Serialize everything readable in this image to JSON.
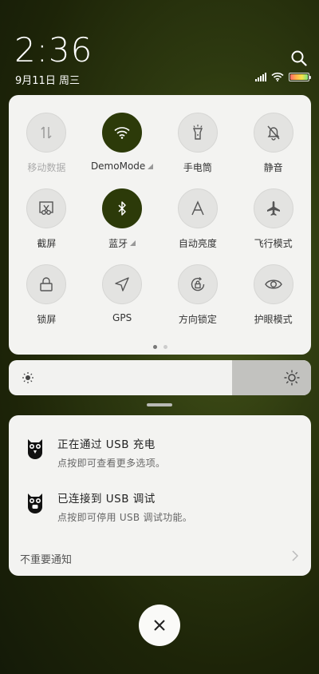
{
  "status": {
    "time": "2:36",
    "date": "9月11日 周三"
  },
  "quick_settings": {
    "tiles": [
      {
        "label": "移动数据",
        "icon": "mobile-data-icon",
        "active": false,
        "disabled": true
      },
      {
        "label": "DemoMode",
        "icon": "wifi-icon",
        "active": true,
        "expand": true
      },
      {
        "label": "手电筒",
        "icon": "flashlight-icon",
        "active": false
      },
      {
        "label": "静音",
        "icon": "bell-off-icon",
        "active": false
      },
      {
        "label": "截屏",
        "icon": "screenshot-icon",
        "active": false
      },
      {
        "label": "蓝牙",
        "icon": "bluetooth-icon",
        "active": true,
        "expand": true
      },
      {
        "label": "自动亮度",
        "icon": "auto-brightness-icon",
        "active": false
      },
      {
        "label": "飞行模式",
        "icon": "airplane-icon",
        "active": false
      },
      {
        "label": "锁屏",
        "icon": "lock-icon",
        "active": false
      },
      {
        "label": "GPS",
        "icon": "location-arrow-icon",
        "active": false
      },
      {
        "label": "方向锁定",
        "icon": "rotation-lock-icon",
        "active": false
      },
      {
        "label": "护眼模式",
        "icon": "eye-icon",
        "active": false
      }
    ],
    "page_count": 2,
    "current_page": 1
  },
  "brightness": {
    "level_fraction": 0.74
  },
  "notifications": [
    {
      "title": "正在通过 USB 充电",
      "subtitle": "点按即可查看更多选项。",
      "icon": "usb-owl-icon"
    },
    {
      "title": "已连接到 USB 调试",
      "subtitle": "点按即可停用 USB 调试功能。",
      "icon": "debug-owl-icon"
    }
  ],
  "footer": {
    "unimportant_label": "不重要通知"
  },
  "colors": {
    "active_tile": "#2c3a09",
    "panel_bg": "#f3f3f1"
  }
}
